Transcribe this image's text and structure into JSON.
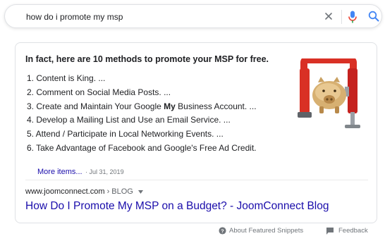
{
  "search": {
    "query": "how do i promote my msp"
  },
  "snippet": {
    "heading": "In fact, here are 10 methods to promote your MSP for free.",
    "items": [
      {
        "pre": "1. Content is King. ...",
        "bold": "",
        "post": ""
      },
      {
        "pre": "2. Comment on Social Media Posts. ...",
        "bold": "",
        "post": ""
      },
      {
        "pre": "3. Create and Maintain Your Google ",
        "bold": "My",
        "post": " Business Account. ..."
      },
      {
        "pre": "4. Develop a Mailing List and Use an Email Service. ...",
        "bold": "",
        "post": ""
      },
      {
        "pre": "5. Attend / Participate in Local Networking Events. ...",
        "bold": "",
        "post": ""
      },
      {
        "pre": "6. Take Advantage of Facebook and Google's Free Ad Credit.",
        "bold": "",
        "post": ""
      }
    ],
    "more_items": "More items...",
    "date": "Jul 31, 2019"
  },
  "result": {
    "domain": "www.joomconnect.com",
    "breadcrumb_sep": "›",
    "breadcrumb": "BLOG",
    "title": "How Do I Promote My MSP on a Budget? - JoomConnect Blog"
  },
  "footer": {
    "about": "About Featured Snippets",
    "feedback": "Feedback"
  },
  "colors": {
    "link": "#1a0dab",
    "mic_blue": "#4285f4",
    "mic_red": "#ea4335",
    "clamp_red": "#d93025",
    "piggy_gold": "#c9a061"
  }
}
